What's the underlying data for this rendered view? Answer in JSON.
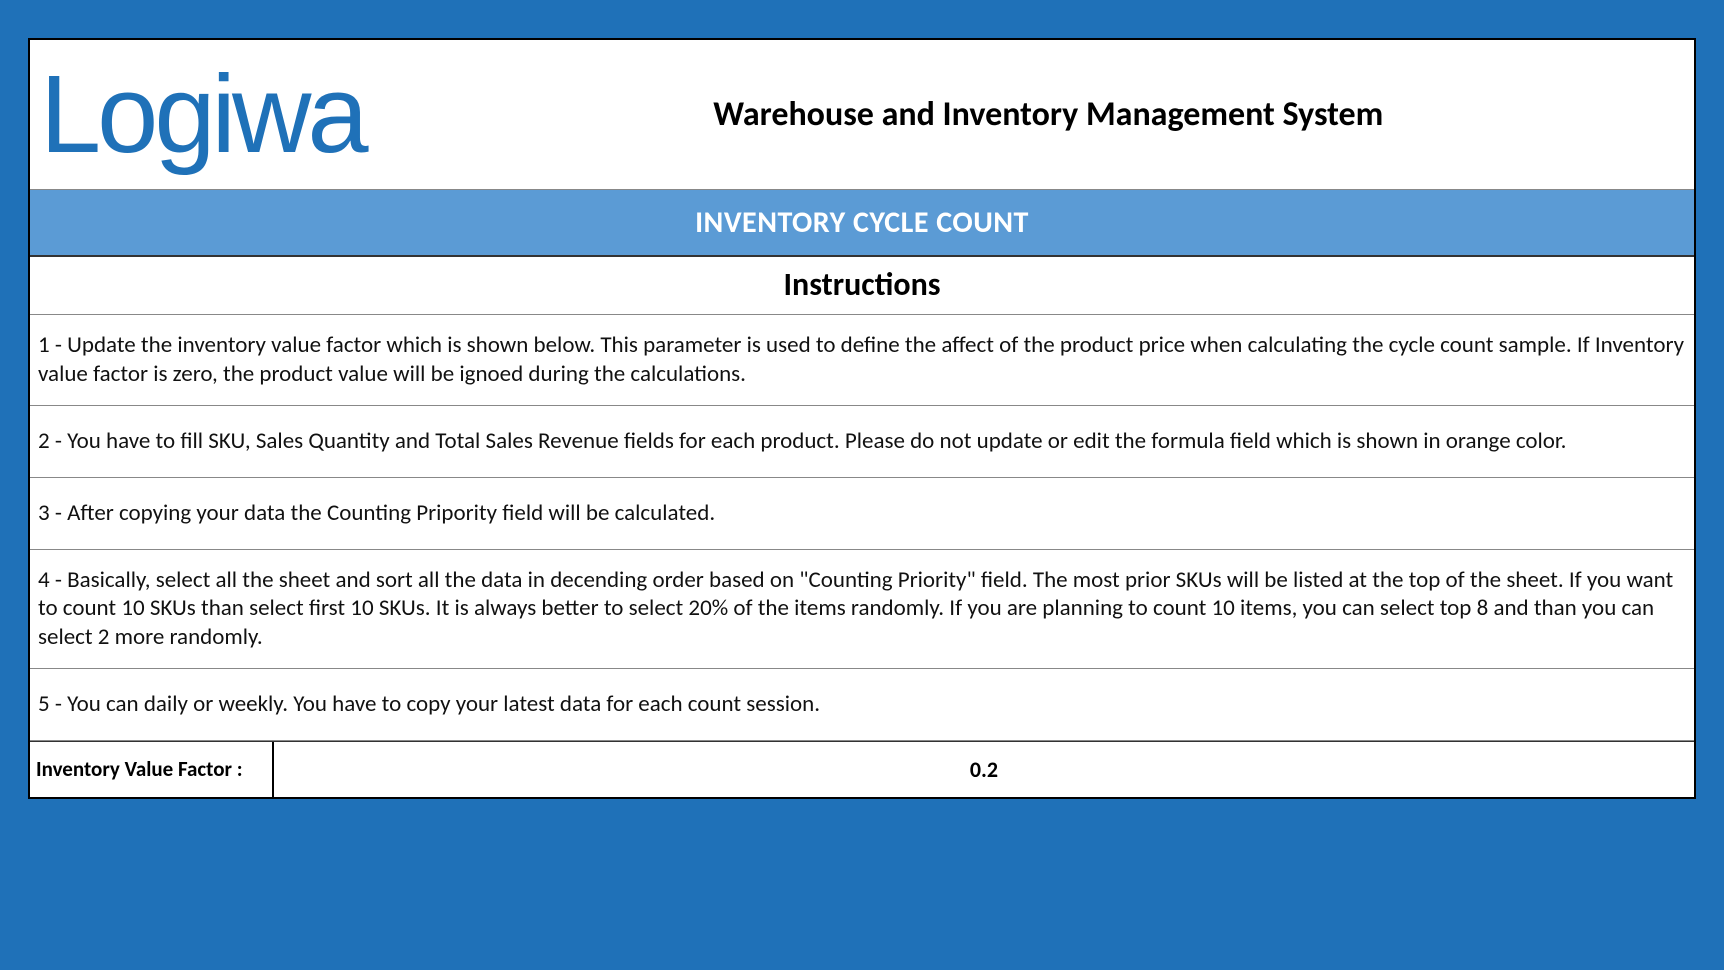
{
  "brand": "Logiwa",
  "header": {
    "system_title": "Warehouse and Inventory Management System"
  },
  "section_title": "INVENTORY CYCLE COUNT",
  "instructions_heading": "Instructions",
  "instructions": [
    "1 - Update the inventory value factor which is shown below. This parameter is used to define the affect of the product price when calculating the cycle count sample. If Inventory value factor is zero, the product value will be ignoed during the calculations.",
    "2 - You have to fill SKU, Sales Quantity and Total Sales Revenue fields for each product. Please do not update or edit the formula field which is shown in orange color.",
    "3 - After copying your data the Counting Pripority field will be calculated.",
    "4 - Basically, select all the sheet and sort all the data in decending order based on \"Counting Priority\" field. The most prior SKUs will be listed at the top of the sheet. If you want to count 10 SKUs than select first 10 SKUs. It is always better to select 20% of the items randomly. If you are planning to count 10 items, you can select top 8 and than you can select 2 more randomly.",
    "5 - You can daily or weekly. You have to copy your latest data for each count session."
  ],
  "value_row": {
    "label": "Inventory Value Factor :",
    "value": "0.2"
  }
}
